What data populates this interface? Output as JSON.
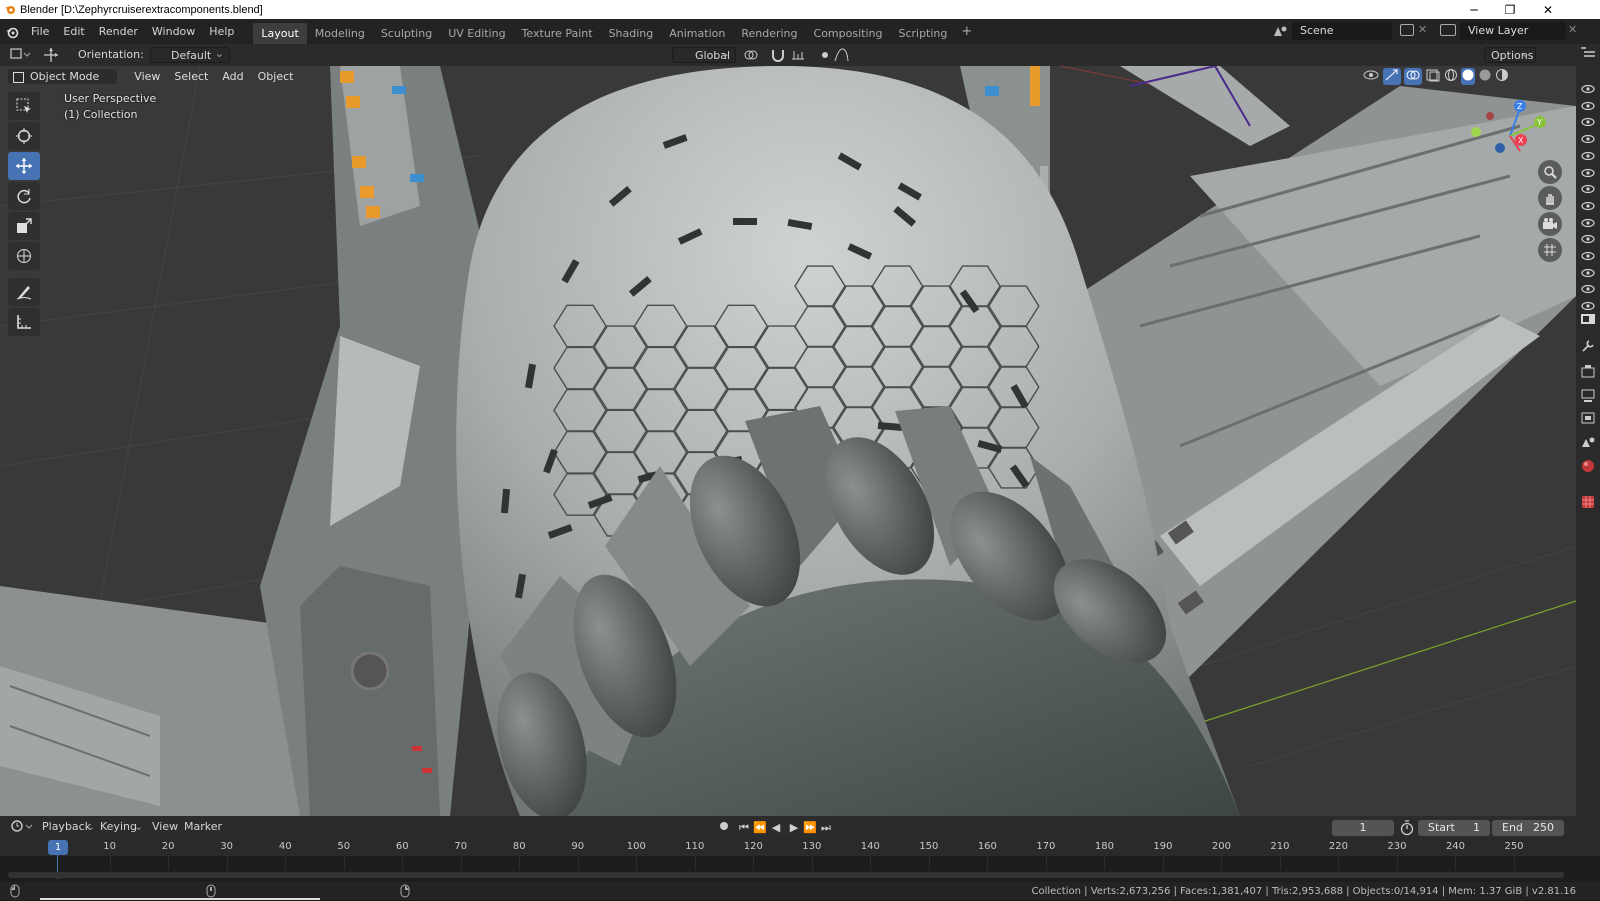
{
  "window": {
    "title": "Blender [D:\\Zephyrcruiserextracomponents.blend]",
    "minimize": "─",
    "maximize": "❐",
    "close": "✕"
  },
  "menu": {
    "items": [
      "File",
      "Edit",
      "Render",
      "Window",
      "Help"
    ]
  },
  "workspaces": {
    "tabs": [
      "Layout",
      "Modeling",
      "Sculpting",
      "UV Editing",
      "Texture Paint",
      "Shading",
      "Animation",
      "Rendering",
      "Compositing",
      "Scripting"
    ],
    "active": "Layout",
    "add": "+"
  },
  "scene": {
    "name": "Scene",
    "view_layer": "View Layer"
  },
  "viewport_header": {
    "orientation_label": "Orientation:",
    "orientation_value": "Default",
    "transform_orientation": "Global",
    "options": "Options"
  },
  "viewport_menu": {
    "mode": "Object Mode",
    "items": [
      "View",
      "Select",
      "Add",
      "Object"
    ]
  },
  "viewport_overlay": {
    "perspective": "User Perspective",
    "collection": "(1) Collection"
  },
  "gizmo": {
    "x": "X",
    "y": "Y",
    "z": "Z",
    "colors": {
      "x": "#ed3f52",
      "y": "#89c43a",
      "z": "#3a7ee6"
    }
  },
  "timeline": {
    "menu": [
      "Playback",
      "Keying",
      "View",
      "Marker"
    ],
    "current_frame": "1",
    "start_label": "Start",
    "start": "1",
    "end_label": "End",
    "end": "250",
    "ticks": [
      "10",
      "20",
      "30",
      "40",
      "50",
      "60",
      "70",
      "80",
      "90",
      "100",
      "110",
      "120",
      "130",
      "140",
      "150",
      "160",
      "170",
      "180",
      "190",
      "200",
      "210",
      "220",
      "230",
      "240",
      "250"
    ],
    "playhead": "1"
  },
  "status": {
    "stats": "Collection | Verts:2,673,256 | Faces:1,381,407 | Tris:2,953,688 | Objects:0/14,914 | Mem: 1.37 GiB | v2.81.16"
  },
  "colors": {
    "accent": "#4772b3",
    "header": "#2b2b2b",
    "background": "#393939"
  }
}
